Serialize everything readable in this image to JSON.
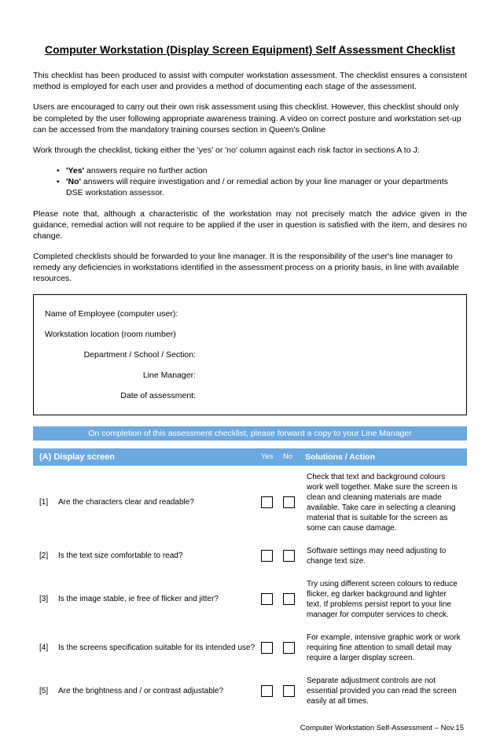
{
  "title": "Computer Workstation (Display Screen Equipment) Self Assessment Checklist",
  "para1": "This checklist has been produced to assist with computer workstation assessment. The checklist ensures a consistent method is employed for each user and provides a method of documenting each stage of the assessment.",
  "para2": "Users are encouraged to carry out their own risk assessment using this checklist. However, this checklist should only be completed by the user following appropriate awareness training. A video on correct posture and workstation set-up can be accessed from the mandatory training courses section in Queen's Online",
  "para3": "Work through the checklist, ticking either the 'yes' or 'no' column against each risk factor in sections A to J:",
  "bullets": {
    "b1_bold": "'Yes'",
    "b1_rest": " answers require no further action",
    "b2_bold": "'No'",
    "b2_rest": " answers will require investigation and / or remedial action by your line manager or your departments DSE workstation assessor."
  },
  "para4": "Please note that, although a characteristic of the workstation may not precisely match the advice given in the guidance, remedial action will not require to be applied if the user in question is satisfied with the item, and desires no change.",
  "para5a": "Completed checklists should be forwarded to your ",
  "para5b": "line manager.",
  "para5c": "  It is the responsibility of the user's line manager ",
  "para5d": "to remedy any deficiencies in workstations identified in the assessment process on a priority basis, in line with available resources.",
  "info": {
    "l1": "Name of Employee (computer user):",
    "l2": "Workstation location (room number)",
    "l3": "Department / School / Section:",
    "l4": "Line Manager:",
    "l5": "Date of assessment:"
  },
  "banner": "On completion of this assessment checklist, please forward a copy to your Line Manager",
  "section": {
    "title": "(A) Display screen",
    "yes": "Yes",
    "no": "No",
    "sol": "Solutions / Action"
  },
  "questions": [
    {
      "num": "[1]",
      "text": "Are the characters clear and readable?",
      "sol": "Check that text and background colours work well together. Make sure the screen is clean and cleaning materials are made available. Take care in selecting a cleaning material that is suitable for the screen as some can cause damage."
    },
    {
      "num": "[2]",
      "text": "Is the text size comfortable to read?",
      "sol": "Software settings may need adjusting to change text size."
    },
    {
      "num": "[3]",
      "text": "Is the image stable, ie free of flicker and jitter?",
      "sol": "Try using different screen colours to reduce flicker, eg darker background and lighter text. If problems persist report to your line manager for computer services to check."
    },
    {
      "num": "[4]",
      "text": "Is the screens specification suitable for its intended use?",
      "sol": "For example, intensive graphic work or work requiring fine attention to small detail may require a larger display screen."
    },
    {
      "num": "[5]",
      "text": "Are the brightness and / or contrast adjustable?",
      "sol": "Separate adjustment controls are not essential provided you can read the screen easily at all times."
    }
  ],
  "footer": "Computer Workstation Self-Assessment – Nov.15"
}
